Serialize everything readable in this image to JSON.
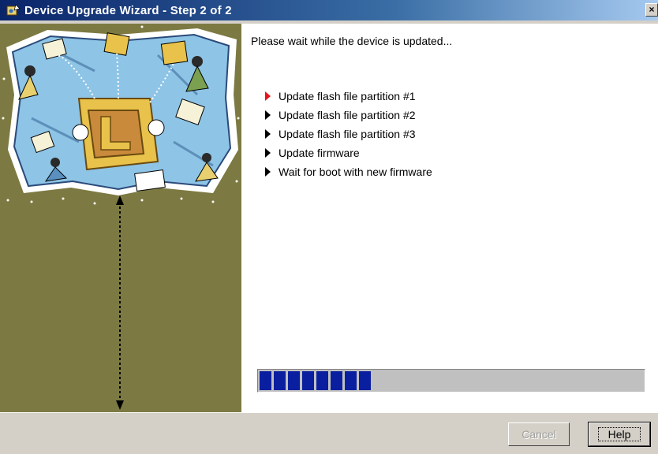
{
  "window": {
    "title": "Device Upgrade Wizard - Step 2 of 2",
    "close_glyph": "×",
    "icon": "wizard-icon"
  },
  "content": {
    "heading": "Please wait while the device is updated...",
    "steps": [
      {
        "label": "Update flash file partition #1",
        "active": true
      },
      {
        "label": "Update flash file partition #2",
        "active": false
      },
      {
        "label": "Update flash file partition #3",
        "active": false
      },
      {
        "label": "Update firmware",
        "active": false
      },
      {
        "label": "Wait for boot with new firmware",
        "active": false
      }
    ],
    "progress": {
      "filled_segments": 8,
      "fraction": 0.31
    }
  },
  "buttons": {
    "cancel": "Cancel",
    "help": "Help"
  },
  "colors": {
    "sidebar": "#7c7a42",
    "progress_fill": "#0a1fa0",
    "active_arrow": "#e8141a"
  }
}
